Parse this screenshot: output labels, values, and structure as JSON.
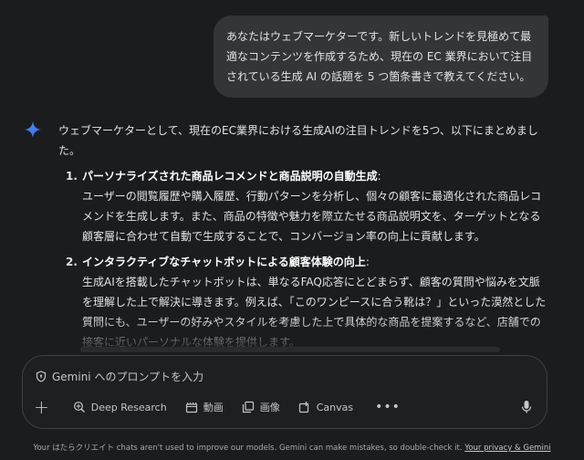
{
  "user_message": "あなたはウェブマーケターです。新しいトレンドを見極めて最適なコンテンツを作成するため、現在の EC 業界において注目されている生成 AI の話題を 5 つ箇条書きで教えてください。",
  "assistant": {
    "intro": "ウェブマーケターとして、現在のEC業界における生成AIの注目トレンドを5つ、以下にまとめました。",
    "trends": [
      {
        "number": "1.",
        "title": "パーソナライズされた商品レコメンドと商品説明の自動生成",
        "colon": ":",
        "body": "ユーザーの閲覧履歴や購入履歴、行動パターンを分析し、個々の顧客に最適化された商品レコメンドを生成します。また、商品の特徴や魅力を際立たせる商品説明文を、ターゲットとなる顧客層に合わせて自動で生成することで、コンバージョン率の向上に貢献します。"
      },
      {
        "number": "2.",
        "title": "インタラクティブなチャットボットによる顧客体験の向上",
        "colon": ":",
        "body": "生成AIを搭載したチャットボットは、単なるFAQ応答にとどまらず、顧客の質問や悩みを文脈を理解した上で解決に導きます。例えば、「このワンピースに合う靴は？」といった漠然とした質問にも、ユーザーの好みやスタイルを考慮した上で具体的な商品を提案するなど、店舗での接客に近いパーソナルな体験を提供します。"
      }
    ]
  },
  "composer": {
    "placeholder": "Gemini へのプロンプトを入力",
    "tools": {
      "deep_research": "Deep Research",
      "video": "動画",
      "image": "画像",
      "canvas": "Canvas",
      "more": "•••"
    }
  },
  "footer": {
    "text": "Your はたらクリエイト chats aren't used to improve our models. Gemini can make mistakes, so double-check it.",
    "link": "Your privacy & Gemini"
  },
  "colors": {
    "background": "#1b1c1d",
    "user_bubble": "#333537",
    "gemini_blue": "#4285f4"
  }
}
